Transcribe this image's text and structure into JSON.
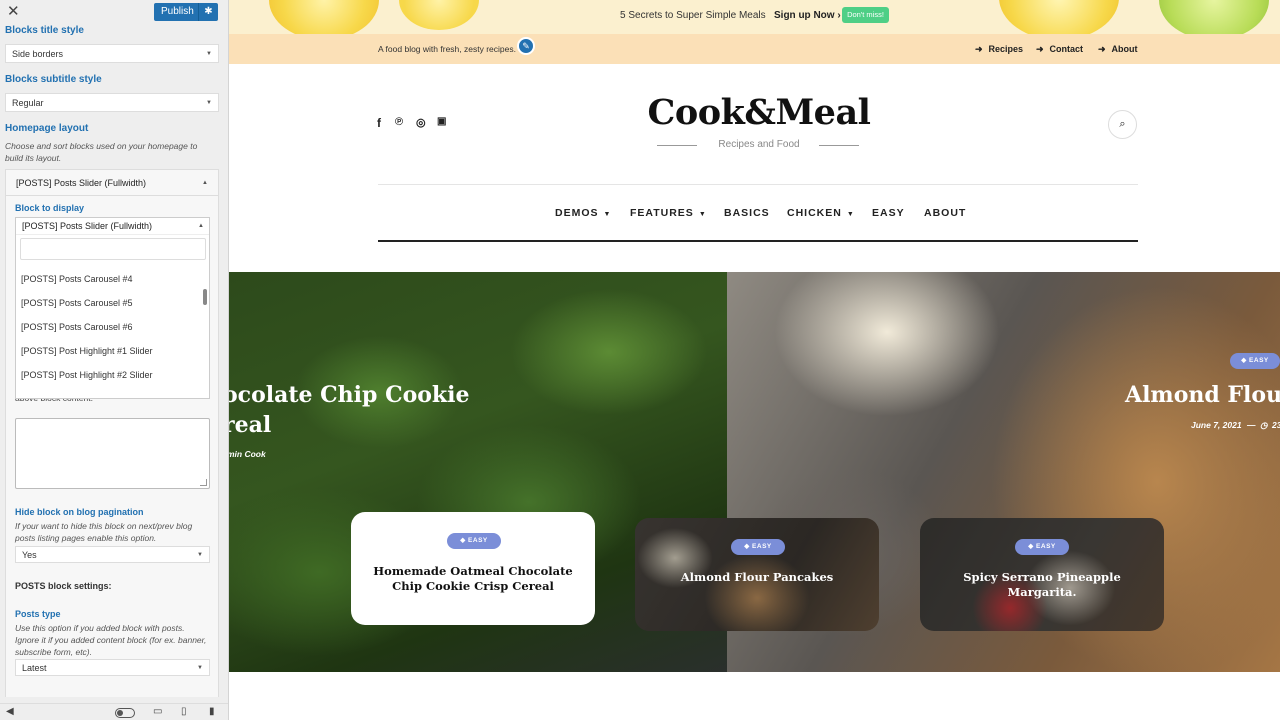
{
  "panel": {
    "close_glyph": "✕",
    "publish_label": "Publish",
    "blocks_title_style": {
      "label": "Blocks title style",
      "value": "Side borders"
    },
    "blocks_subtitle_style": {
      "label": "Blocks subtitle style",
      "value": "Regular"
    },
    "homepage_layout": {
      "label": "Homepage layout",
      "desc": "Choose and sort blocks used on your homepage to build its layout."
    },
    "block_section": {
      "header": "[POSTS] Posts Slider (Fullwidth)",
      "block_to_display_label": "Block to display",
      "block_to_display_value": "[POSTS] Posts Slider (Fullwidth)",
      "options": [
        "[POSTS] Posts Carousel #4",
        "[POSTS] Posts Carousel #5",
        "[POSTS] Posts Carousel #6",
        "[POSTS] Post Highlight #1 Slider",
        "[POSTS] Post Highlight #2 Slider"
      ],
      "partial_desc": "above block content.",
      "hide_pagination": {
        "label": "Hide block on blog pagination",
        "desc": "If your want to hide this block on next/prev blog posts listing pages enable this option.",
        "value": "Yes"
      },
      "posts_settings_label": "POSTS block settings:",
      "posts_type": {
        "label": "Posts type",
        "desc": "Use this option if you added block with posts. Ignore it if you added content block (for ex. banner, subscribe form, etc).",
        "value": "Latest"
      }
    }
  },
  "preview": {
    "announcement": {
      "text": "5 Secrets to Super Simple Meals",
      "signup": "Sign up Now",
      "button": "Don't miss!"
    },
    "topbar": {
      "tagline": "A food blog with fresh, zesty recipes.",
      "links": [
        "Recipes",
        "Contact",
        "About"
      ]
    },
    "logo": {
      "title": "Cook&Meal",
      "subtitle": "Recipes and Food"
    },
    "nav": [
      "DEMOS",
      "FEATURES",
      "BASICS",
      "CHICKEN",
      "EASY",
      "ABOUT"
    ],
    "hero": {
      "left_title_line1": "ocolate Chip Cookie",
      "left_title_line2": "real",
      "left_meta": "min Cook",
      "right_badge": "EASY",
      "right_title": "Almond Flour",
      "right_date": "June 7, 2021",
      "right_meta_tail": "23",
      "cards": [
        {
          "badge": "EASY",
          "title": "Homemade Oatmeal Chocolate Chip Cookie Crisp Cereal"
        },
        {
          "badge": "EASY",
          "title": "Almond Flour Pancakes"
        },
        {
          "badge": "EASY",
          "title": "Spicy Serrano Pineapple Margarita."
        }
      ]
    }
  },
  "colors": {
    "accent": "#2271b1",
    "badge": "#7b8ed8",
    "cta": "#4ecf86",
    "topbar": "#fbe0b7"
  }
}
